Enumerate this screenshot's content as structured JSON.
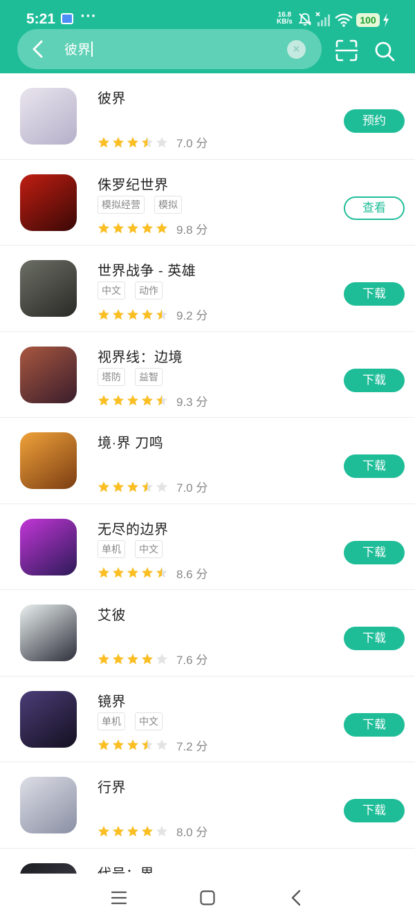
{
  "status_bar": {
    "time": "5:21",
    "dots": "···",
    "net_speed_value": "16.8",
    "net_speed_unit": "KB/s",
    "battery": "100",
    "icons": [
      "wallet-card-icon",
      "bell-muted-icon",
      "signal-icon",
      "wifi-icon",
      "battery-icon",
      "charging-bolt-icon"
    ]
  },
  "search": {
    "query": "彼界",
    "back_icon": "chevron-left-icon",
    "clear_icon": "clear-x-icon",
    "clear_glyph": "×",
    "scan_icon": "scan-icon",
    "search_icon": "search-icon"
  },
  "colors": {
    "brand": "#1ebd98",
    "star": "#fbbf24",
    "star_empty": "#e3e3e3"
  },
  "apps": [
    {
      "name": "彼界",
      "tags": [],
      "stars": 3.5,
      "score": "7.0 分",
      "action": "预约",
      "style": "fill",
      "icon_colors": [
        "#e9e5ee",
        "#b5b0c9"
      ]
    },
    {
      "name": "侏罗纪世界",
      "tags": [
        "模拟经营",
        "模拟"
      ],
      "stars": 5,
      "score": "9.8 分",
      "action": "查看",
      "style": "outline",
      "icon_colors": [
        "#c01e12",
        "#3a0806"
      ]
    },
    {
      "name": "世界战争 - 英雄",
      "tags": [
        "中文",
        "动作"
      ],
      "stars": 4.5,
      "score": "9.2 分",
      "action": "下载",
      "style": "fill",
      "icon_colors": [
        "#6c6f66",
        "#2a2a26"
      ]
    },
    {
      "name": "视界线：边境",
      "tags": [
        "塔防",
        "益智"
      ],
      "stars": 4.5,
      "score": "9.3 分",
      "action": "下载",
      "style": "fill",
      "icon_colors": [
        "#a8573f",
        "#3a1d2c"
      ]
    },
    {
      "name": "境·界 刀鸣",
      "tags": [],
      "stars": 3.5,
      "score": "7.0 分",
      "action": "下载",
      "style": "fill",
      "icon_colors": [
        "#f0a23a",
        "#7b3d12"
      ]
    },
    {
      "name": "无尽的边界",
      "tags": [
        "单机",
        "中文"
      ],
      "stars": 4.5,
      "score": "8.6 分",
      "action": "下载",
      "style": "fill",
      "icon_colors": [
        "#c236d6",
        "#2c1a58"
      ]
    },
    {
      "name": "艾彼",
      "tags": [],
      "stars": 4,
      "score": "7.6 分",
      "action": "下载",
      "style": "fill",
      "icon_colors": [
        "#e9f0ee",
        "#2e2f3b"
      ]
    },
    {
      "name": "镜界",
      "tags": [
        "单机",
        "中文"
      ],
      "stars": 3.5,
      "score": "7.2 分",
      "action": "下载",
      "style": "fill",
      "icon_colors": [
        "#4b3d78",
        "#141020"
      ]
    },
    {
      "name": "行界",
      "tags": [],
      "stars": 4,
      "score": "8.0 分",
      "action": "下载",
      "style": "fill",
      "icon_colors": [
        "#dcdee6",
        "#8a8fa3"
      ]
    },
    {
      "name": "代号：界",
      "tags": [],
      "stars": 0,
      "score": "",
      "action": "",
      "style": "none",
      "icon_colors": [
        "#1c1c22",
        "#4a4a56"
      ]
    }
  ],
  "nav": {
    "icons": [
      "menu-icon",
      "home-icon",
      "back-icon"
    ]
  }
}
